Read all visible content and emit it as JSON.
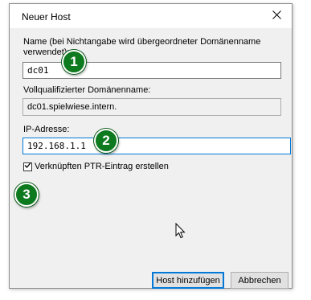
{
  "window": {
    "title": "Neuer Host"
  },
  "fields": {
    "name_label": "Name (bei Nichtangabe wird übergeordneter Domänenname verwendet):",
    "name_value": "dc01",
    "fqdn_label": "Vollqualifizierter Domänenname:",
    "fqdn_value": "dc01.spielwiese.intern.",
    "ip_label": "IP-Adresse:",
    "ip_value": "192.168.1.1"
  },
  "checkbox": {
    "label": "Verknüpften PTR-Eintrag erstellen",
    "checked": true
  },
  "badges": [
    "1",
    "2",
    "3"
  ],
  "buttons": {
    "add_host": "Host hinzufügen",
    "cancel": "Abbrechen"
  },
  "colors": {
    "badge": "#0e7a20",
    "focus_border": "#0078d7",
    "dialog_bg": "#f0f0f0"
  },
  "icons": {
    "close": "close-icon",
    "check": "checkmark-icon",
    "cursor": "mouse-cursor-icon"
  }
}
